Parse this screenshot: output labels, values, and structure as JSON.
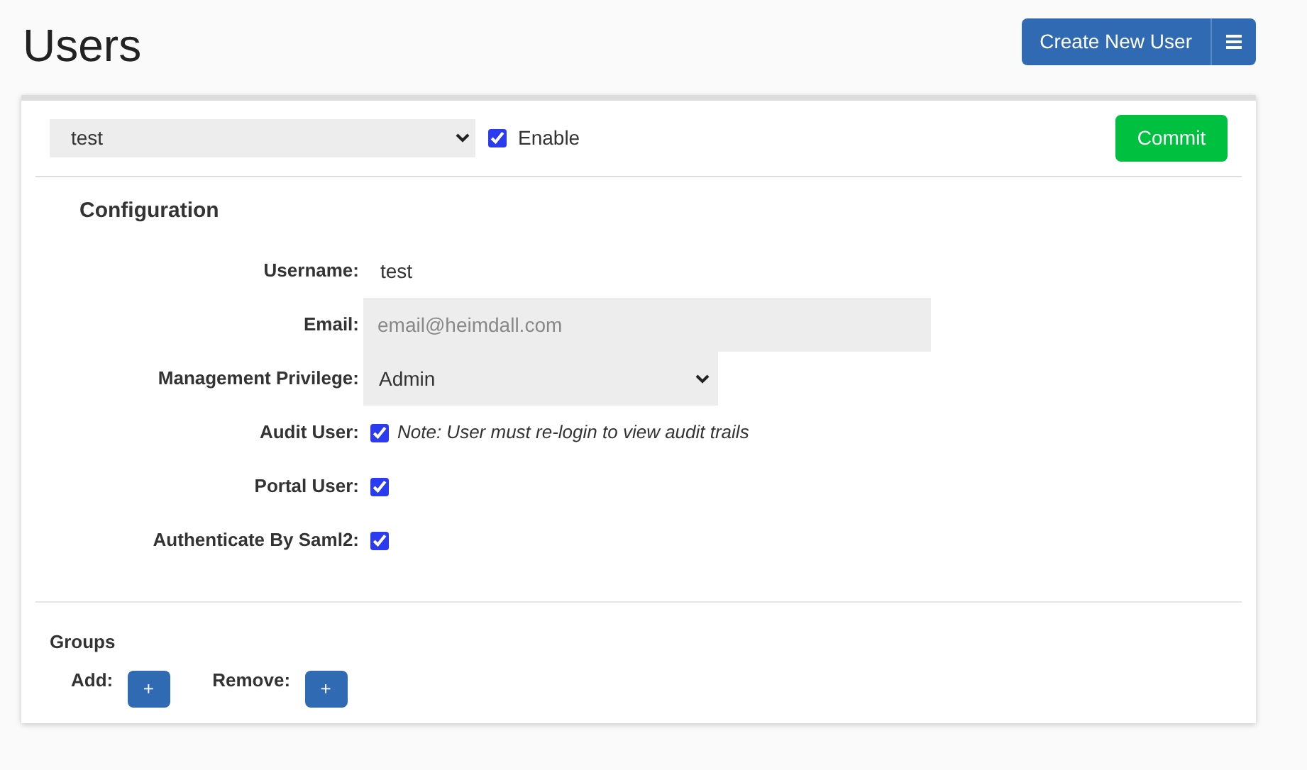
{
  "page_title": "Users",
  "create_button": {
    "label": "Create New User"
  },
  "user_select": {
    "value": "test"
  },
  "enable": {
    "label": "Enable",
    "checked": true
  },
  "commit_button": {
    "label": "Commit"
  },
  "configuration": {
    "title": "Configuration",
    "fields": [
      {
        "kind": "text",
        "label": "Username:",
        "value": "test"
      },
      {
        "kind": "input",
        "label": "Email:",
        "placeholder": "email@heimdall.com"
      },
      {
        "kind": "select",
        "label": "Management Privilege:",
        "value": "Admin"
      },
      {
        "kind": "checkbox",
        "label": "Audit User:",
        "checked": true,
        "note": "Note: User must re-login to view audit trails"
      },
      {
        "kind": "checkbox",
        "label": "Portal User:",
        "checked": true
      },
      {
        "kind": "checkbox",
        "label": "Authenticate By Saml2:",
        "checked": true
      }
    ]
  },
  "groups": {
    "title": "Groups",
    "actions": [
      {
        "label": "Add:",
        "button": "+"
      },
      {
        "label": "Remove:",
        "button": "+"
      }
    ]
  }
}
